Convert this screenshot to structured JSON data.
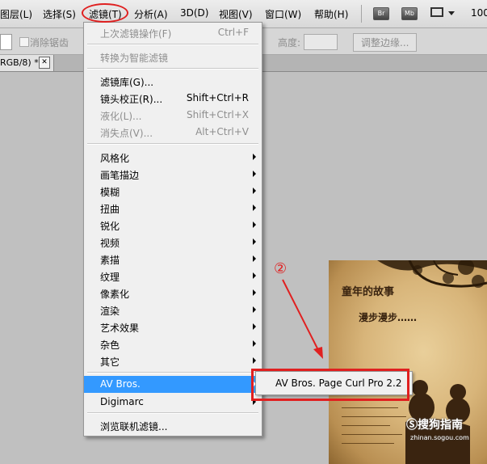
{
  "menubar": {
    "items": [
      "图层(L)",
      "选择(S)",
      "滤镜(T)",
      "分析(A)",
      "3D(D)",
      "视图(V)",
      "窗口(W)",
      "帮助(H)"
    ],
    "bridge_btn": "Br",
    "minibridge_btn": "Mb",
    "zoom": "100"
  },
  "options": {
    "antialias": "消除锯齿",
    "height_label": "高度:",
    "refine_edge": "调整边缘..."
  },
  "document_tab": {
    "title": "RGB/8) *",
    "close": "✕"
  },
  "filter_menu": {
    "last_filter": {
      "label": "上次滤镜操作(F)",
      "shortcut": "Ctrl+F"
    },
    "smart_filter": "转换为智能滤镜",
    "gallery": "滤镜库(G)...",
    "lens": {
      "label": "镜头校正(R)...",
      "shortcut": "Shift+Ctrl+R"
    },
    "liquify": {
      "label": "液化(L)...",
      "shortcut": "Shift+Ctrl+X"
    },
    "vanishing": {
      "label": "消失点(V)...",
      "shortcut": "Alt+Ctrl+V"
    },
    "submenus": [
      "风格化",
      "画笔描边",
      "模糊",
      "扭曲",
      "锐化",
      "视频",
      "素描",
      "纹理",
      "像素化",
      "渲染",
      "艺术效果",
      "杂色",
      "其它"
    ],
    "av_bros": "AV Bros.",
    "digimarc": "Digimarc",
    "browse_online": "浏览联机滤镜..."
  },
  "av_submenu": {
    "item": "AV Bros. Page Curl Pro 2.2"
  },
  "annotation": {
    "number": "②",
    "accent": "#e02020"
  },
  "photo": {
    "title": "童年的故事",
    "subtitle": "漫步漫步……"
  },
  "watermark": {
    "text": "Ⓢ搜狗指南",
    "url": "zhinan.sogou.com"
  }
}
